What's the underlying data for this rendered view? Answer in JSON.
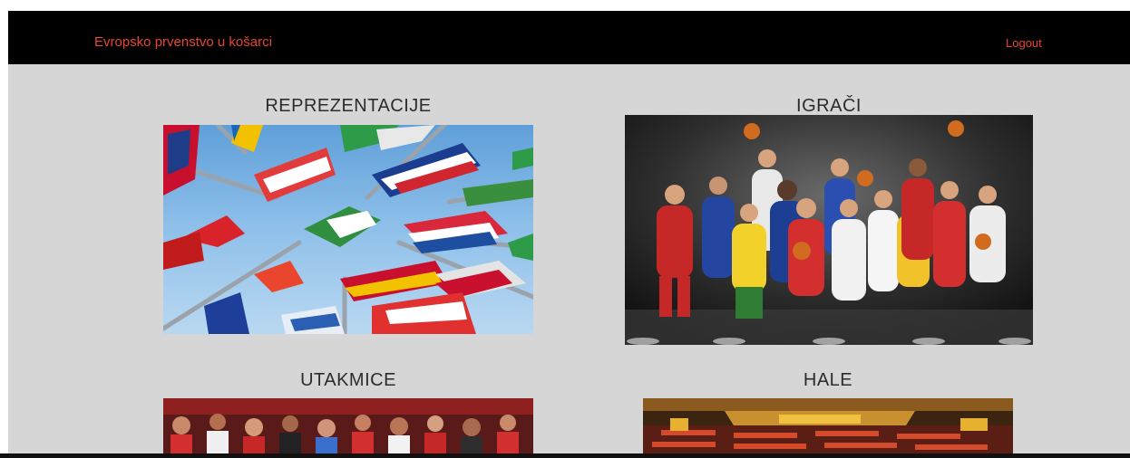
{
  "navbar": {
    "brand": "Evropsko prvenstvo u košarci",
    "logout": "Logout"
  },
  "sections": {
    "reprezentacije": {
      "title": "REPREZENTACIJE",
      "image": "flags-photo"
    },
    "igraci": {
      "title": "IGRAČI",
      "image": "players-photo"
    },
    "utakmice": {
      "title": "UTAKMICE",
      "image": "crowd-photo"
    },
    "hale": {
      "title": "HALE",
      "image": "arena-photo"
    }
  },
  "colors": {
    "navbar_bg": "#000000",
    "accent": "#e9462d",
    "page_bg": "#d6d6d6"
  }
}
